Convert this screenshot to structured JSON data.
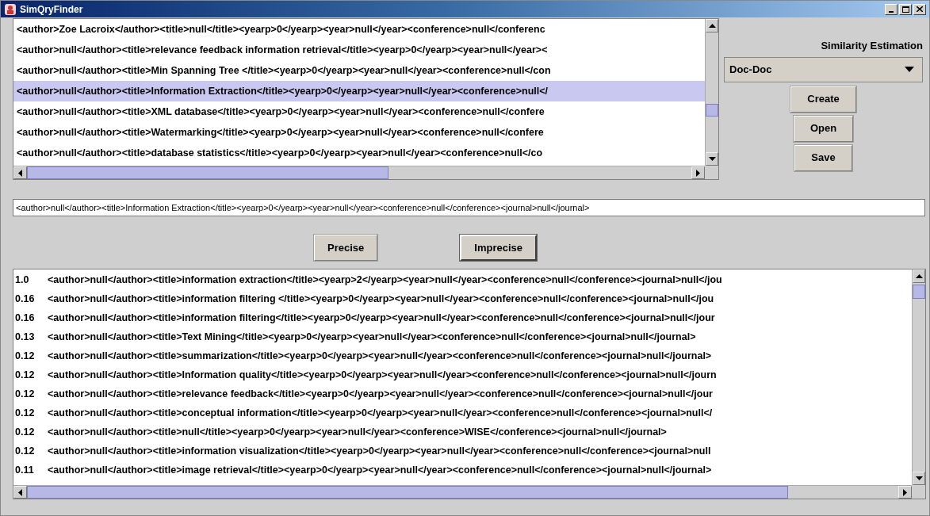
{
  "window": {
    "title": "SimQryFinder"
  },
  "documents": [
    {
      "text": "<author>Zoe Lacroix</author><title>null</title><yearp>0</yearp><year>null</year><conference>null</conferenc",
      "selected": false
    },
    {
      "text": "<author>null</author><title>relevance feedback information retrieval</title><yearp>0</yearp><year>null</year><",
      "selected": false
    },
    {
      "text": "<author>null</author><title>Min Spanning Tree </title><yearp>0</yearp><year>null</year><conference>null</con",
      "selected": false
    },
    {
      "text": "<author>null</author><title>Information Extraction</title><yearp>0</yearp><year>null</year><conference>null</",
      "selected": true
    },
    {
      "text": "<author>null</author><title>XML database</title><yearp>0</yearp><year>null</year><conference>null</confere",
      "selected": false
    },
    {
      "text": "<author>null</author><title>Watermarking</title><yearp>0</yearp><year>null</year><conference>null</confere",
      "selected": false
    },
    {
      "text": "<author>null</author><title>database statistics</title><yearp>0</yearp><year>null</year><conference>null</co",
      "selected": false
    }
  ],
  "similarity": {
    "label": "Similarity Estimation",
    "value": "Doc-Doc"
  },
  "file_buttons": [
    "Create",
    "Open",
    "Save"
  ],
  "query": {
    "value": "<author>null</author><title>Information Extraction</title><yearp>0</yearp><year>null</year><conference>null</conference><journal>null</journal>"
  },
  "match_buttons": [
    {
      "label": "Precise",
      "focused": false
    },
    {
      "label": "Imprecise",
      "focused": true
    }
  ],
  "results": [
    {
      "score": "1.0",
      "text": "<author>null</author><title>information extraction</title><yearp>2</yearp><year>null</year><conference>null</conference><journal>null</jou"
    },
    {
      "score": "0.16",
      "text": "<author>null</author><title>information filtering </title><yearp>0</yearp><year>null</year><conference>null</conference><journal>null</jou"
    },
    {
      "score": "0.16",
      "text": "<author>null</author><title>information filtering</title><yearp>0</yearp><year>null</year><conference>null</conference><journal>null</jour"
    },
    {
      "score": "0.13",
      "text": "<author>null</author><title>Text Mining</title><yearp>0</yearp><year>null</year><conference>null</conference><journal>null</journal>"
    },
    {
      "score": "0.12",
      "text": "<author>null</author><title>summarization</title><yearp>0</yearp><year>null</year><conference>null</conference><journal>null</journal>"
    },
    {
      "score": "0.12",
      "text": "<author>null</author><title>Information quality</title><yearp>0</yearp><year>null</year><conference>null</conference><journal>null</journ"
    },
    {
      "score": "0.12",
      "text": "<author>null</author><title>relevance feedback</title><yearp>0</yearp><year>null</year><conference>null</conference><journal>null</jour"
    },
    {
      "score": "0.12",
      "text": "<author>null</author><title>conceptual information</title><yearp>0</yearp><year>null</year><conference>null</conference><journal>null</"
    },
    {
      "score": "0.12",
      "text": "<author>null</author><title>null</title><yearp>0</yearp><year>null</year><conference>WISE</conference><journal>null</journal>"
    },
    {
      "score": "0.12",
      "text": "<author>null</author><title>information visualization</title><yearp>0</yearp><year>null</year><conference>null</conference><journal>null"
    },
    {
      "score": "0.11",
      "text": "<author>null</author><title>image retrieval</title><yearp>0</yearp><year>null</year><conference>null</conference><journal>null</journal>"
    }
  ]
}
